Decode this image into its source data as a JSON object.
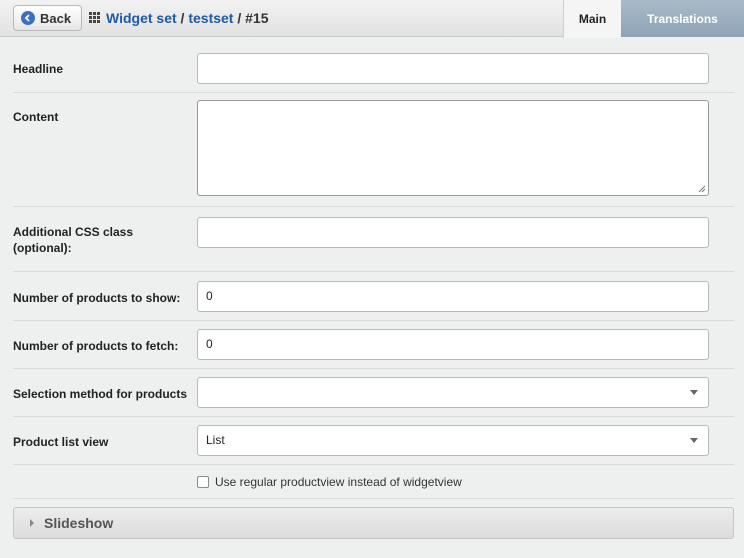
{
  "header": {
    "back_label": "Back",
    "breadcrumb": {
      "root": "Widget set",
      "sep1": " / ",
      "set": "testset",
      "sep2": " / ",
      "current": "#15"
    },
    "tabs": [
      {
        "label": "Main",
        "active": true
      },
      {
        "label": "Translations",
        "active": false
      }
    ]
  },
  "form": {
    "headline": {
      "label": "Headline",
      "value": ""
    },
    "content": {
      "label": "Content",
      "value": ""
    },
    "css_class": {
      "label_line1": "Additional CSS class",
      "label_line2": "(optional):",
      "value": ""
    },
    "products_show": {
      "label": "Number of products to show:",
      "value": "0"
    },
    "products_fetch": {
      "label": "Number of products to fetch:",
      "value": "0"
    },
    "selection_method": {
      "label": "Selection method for products",
      "value": ""
    },
    "list_view": {
      "label": "Product list view",
      "value": "List"
    },
    "regular_view": {
      "label": "Use regular productview instead of widgetview",
      "checked": false
    }
  },
  "panels": {
    "slideshow": "Slideshow"
  },
  "colors": {
    "link": "#1f5aa8",
    "tab_translations": "#9aaebf",
    "background": "#eef0ef"
  }
}
